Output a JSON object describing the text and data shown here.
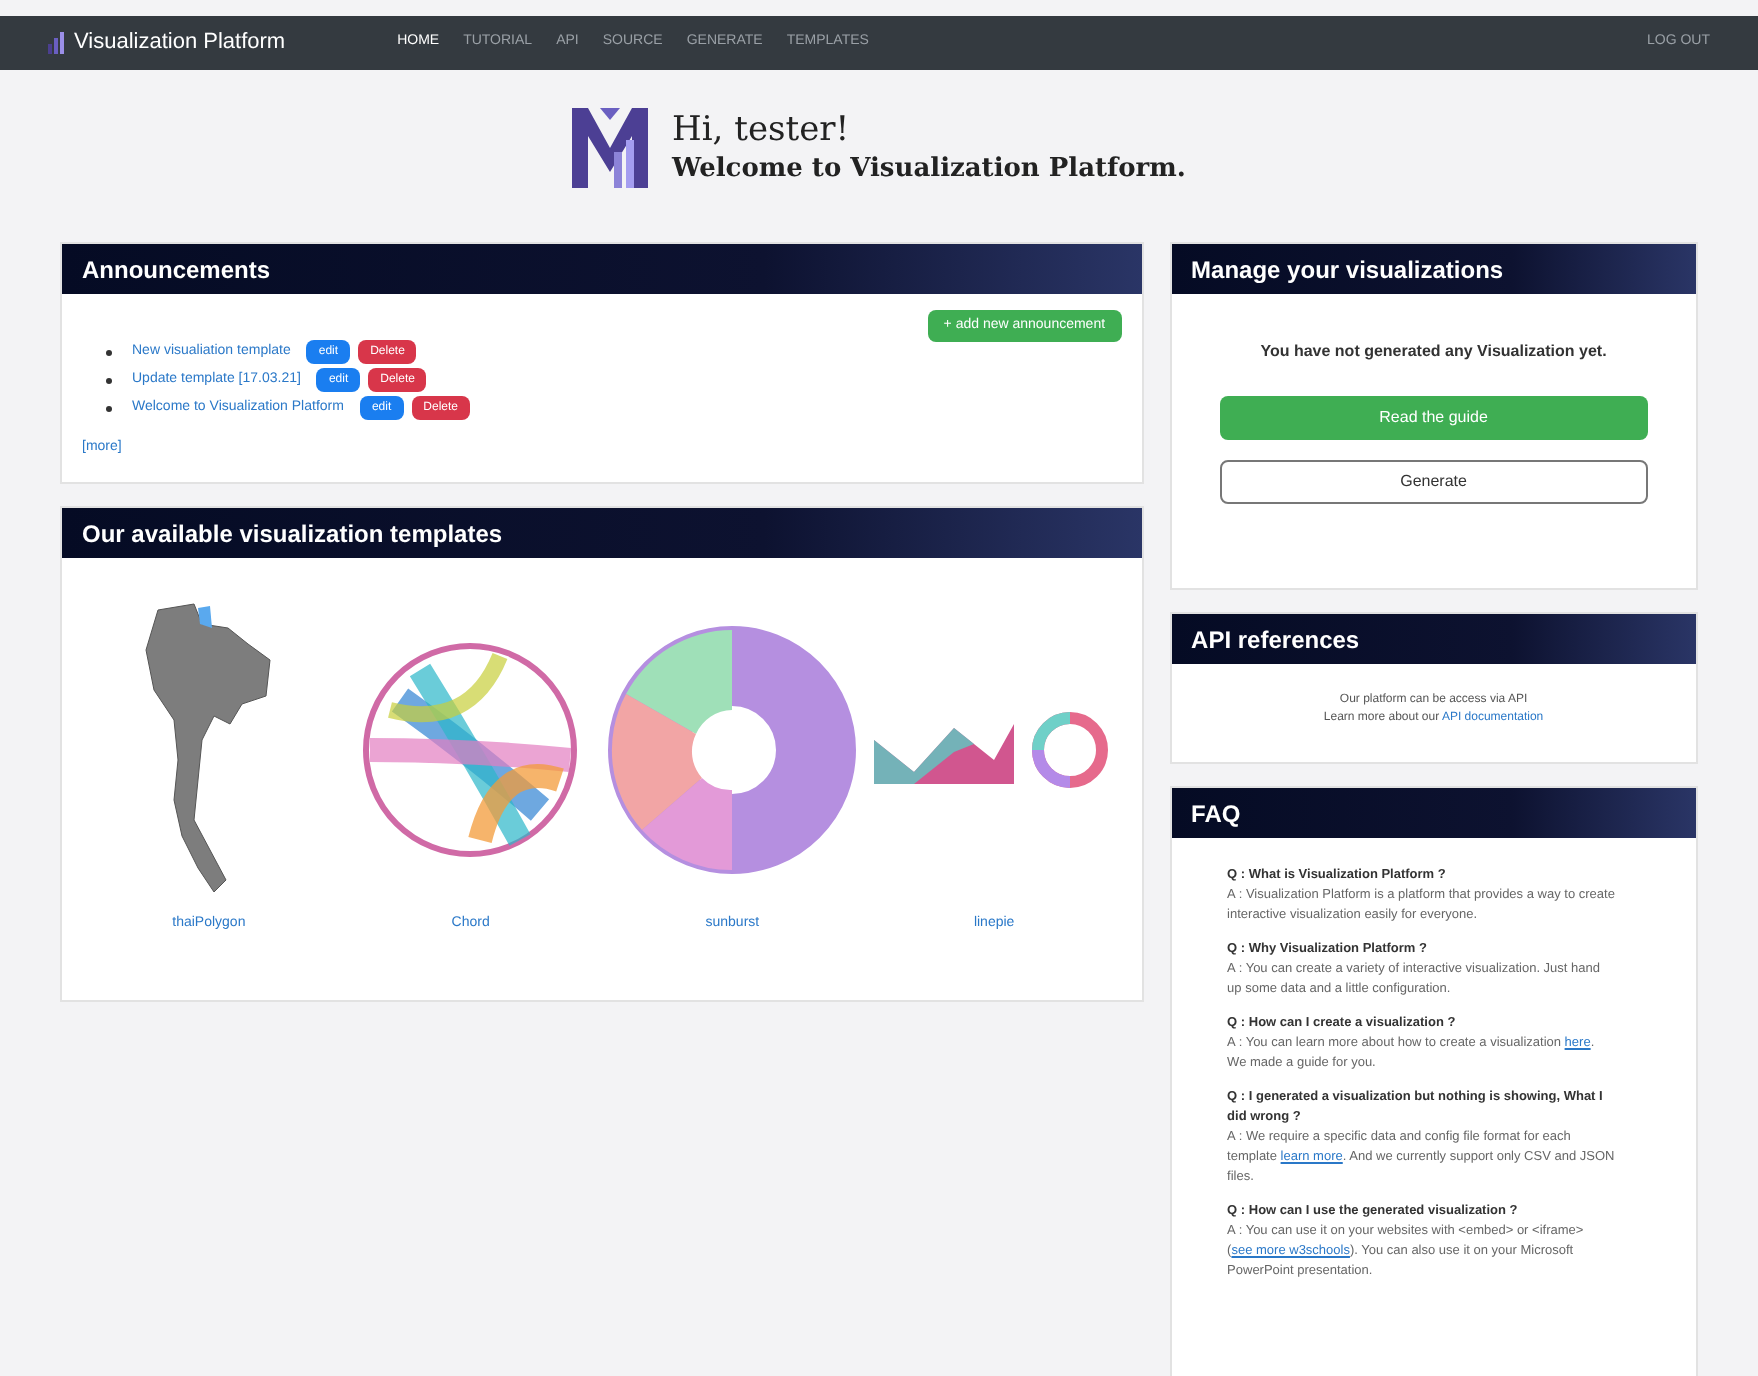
{
  "navbar": {
    "brand": "Visualization Platform",
    "links": [
      {
        "label": "HOME",
        "selected": true
      },
      {
        "label": "TUTORIAL",
        "selected": false
      },
      {
        "label": "API",
        "selected": false
      },
      {
        "label": "SOURCE",
        "selected": false
      },
      {
        "label": "GENERATE",
        "selected": false
      },
      {
        "label": "TEMPLATES",
        "selected": false
      }
    ],
    "logout": "LOG OUT"
  },
  "hero": {
    "greeting": "Hi, tester!",
    "welcome": "Welcome to Visualization Platform."
  },
  "announcements": {
    "title": "Announcements",
    "add_button": "+ add new announcement",
    "items": [
      {
        "title": "New visualiation template",
        "edit": "edit",
        "delete": "Delete"
      },
      {
        "title": "Update template [17.03.21]",
        "edit": "edit",
        "delete": "Delete"
      },
      {
        "title": "Welcome to Visualization Platform",
        "edit": "edit",
        "delete": "Delete"
      }
    ],
    "more": "[more]"
  },
  "templates": {
    "title": "Our available visualization templates",
    "items": [
      {
        "kind": "map",
        "name": "thaiPolygon"
      },
      {
        "kind": "chord",
        "name": "Chord"
      },
      {
        "kind": "sunburst",
        "name": "sunburst"
      },
      {
        "kind": "linepie",
        "name": "linepie"
      }
    ]
  },
  "manage": {
    "title": "Manage your visualizations",
    "message": "You have not generated any Visualization yet.",
    "primary_button": "Read the guide",
    "secondary_button": "Generate"
  },
  "api": {
    "title": "API references",
    "line1": "Our platform can be access via API",
    "line2": "Learn more about our ",
    "link": "API documentation"
  },
  "faq": {
    "title": "FAQ",
    "items": [
      {
        "question": "Q : What is Visualization Platform ?",
        "answer": [
          {
            "kind": "text",
            "text": "A : Visualization Platform is a platform that provides a way to create interactive visualization easily for everyone."
          }
        ]
      },
      {
        "question": "Q : Why Visualization Platform ?",
        "answer": [
          {
            "kind": "text",
            "text": "A : You can create a variety of interactive visualization. Just hand up some data and a little configuration."
          }
        ]
      },
      {
        "question": "Q : How can I create a visualization ?",
        "answer": [
          {
            "kind": "text",
            "text": "A : You can learn more about how to create a visualization "
          },
          {
            "kind": "link",
            "text": "here"
          },
          {
            "kind": "text",
            "text": ". We made a guide for you."
          }
        ]
      },
      {
        "question": "Q : I generated a visualization but nothing is showing, What I did wrong ?",
        "answer": [
          {
            "kind": "text",
            "text": "A : We require a specific data and config file format for each template "
          },
          {
            "kind": "link",
            "text": "learn more"
          },
          {
            "kind": "text",
            "text": ". And we currently support only CSV and JSON files."
          }
        ]
      },
      {
        "question": "Q : How can I use the generated visualization ?",
        "answer": [
          {
            "kind": "text",
            "text": "A : You can use it on your websites with <embed> or <iframe> ("
          },
          {
            "kind": "link",
            "text": "see more w3schools"
          },
          {
            "kind": "text",
            "text": "). You can also use it on your Microsoft PowerPoint presentation."
          }
        ]
      }
    ]
  }
}
